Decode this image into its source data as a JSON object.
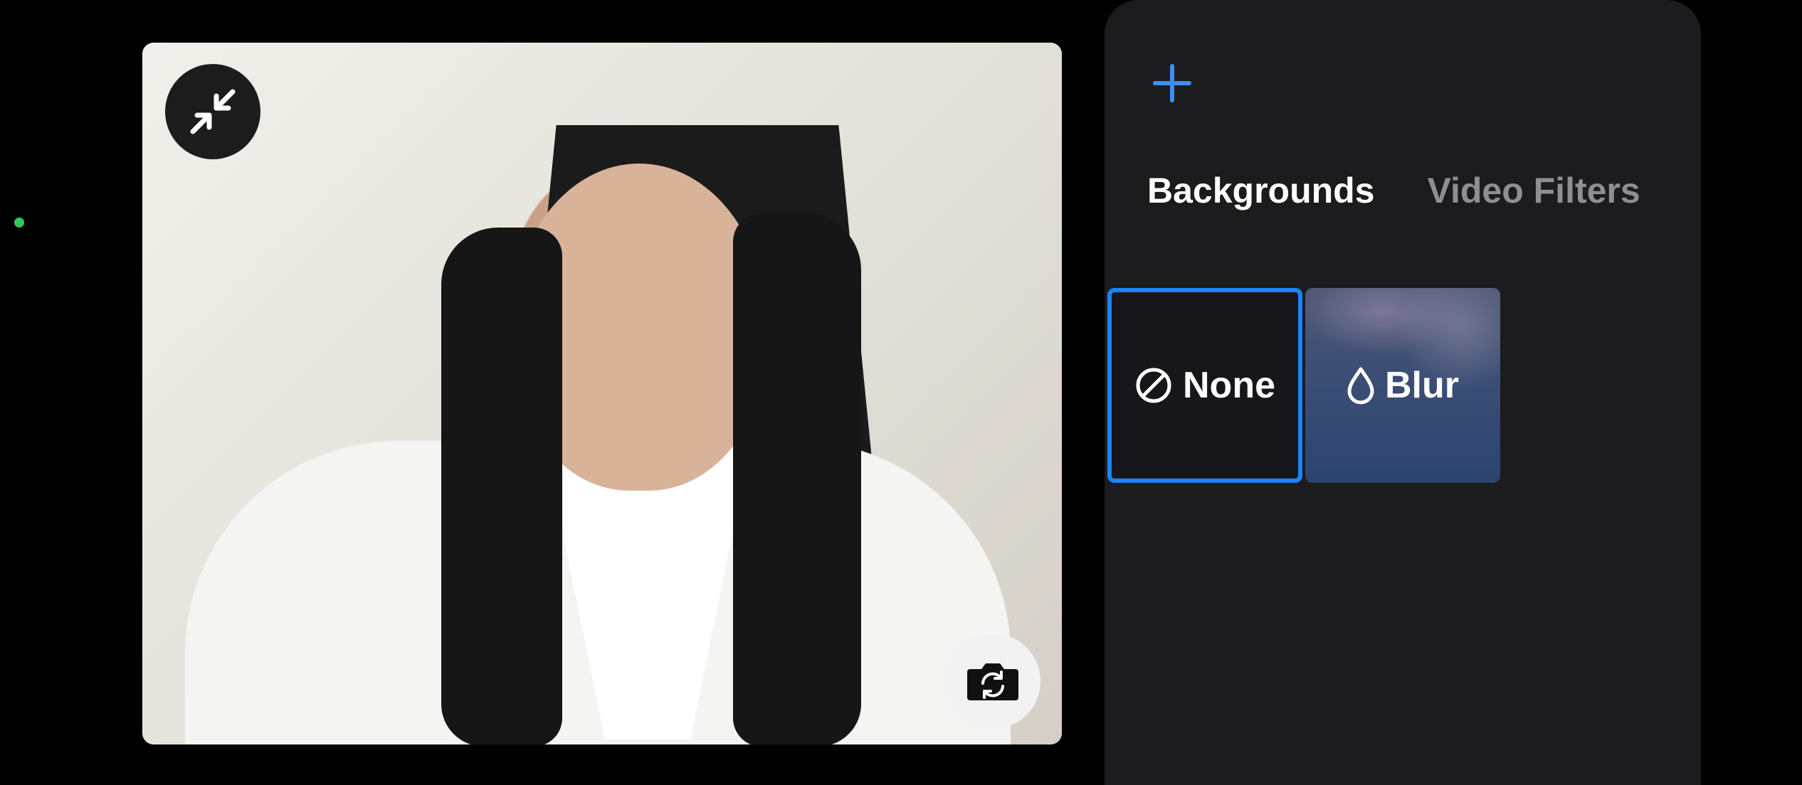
{
  "camera_preview": {
    "collapse_icon": "collapse-arrows-icon",
    "flip_camera_icon": "camera-flip-icon"
  },
  "panel": {
    "add_icon": "plus-icon",
    "tabs": [
      {
        "label": "Backgrounds",
        "active": true
      },
      {
        "label": "Video Filters",
        "active": false
      }
    ],
    "options": [
      {
        "label": "None",
        "icon": "prohibited-icon",
        "selected": true
      },
      {
        "label": "Blur",
        "icon": "droplet-icon",
        "selected": false
      }
    ]
  },
  "colors": {
    "accent": "#1a84ff",
    "panel_background": "#1c1c1e",
    "status_dot": "#30c85a"
  }
}
